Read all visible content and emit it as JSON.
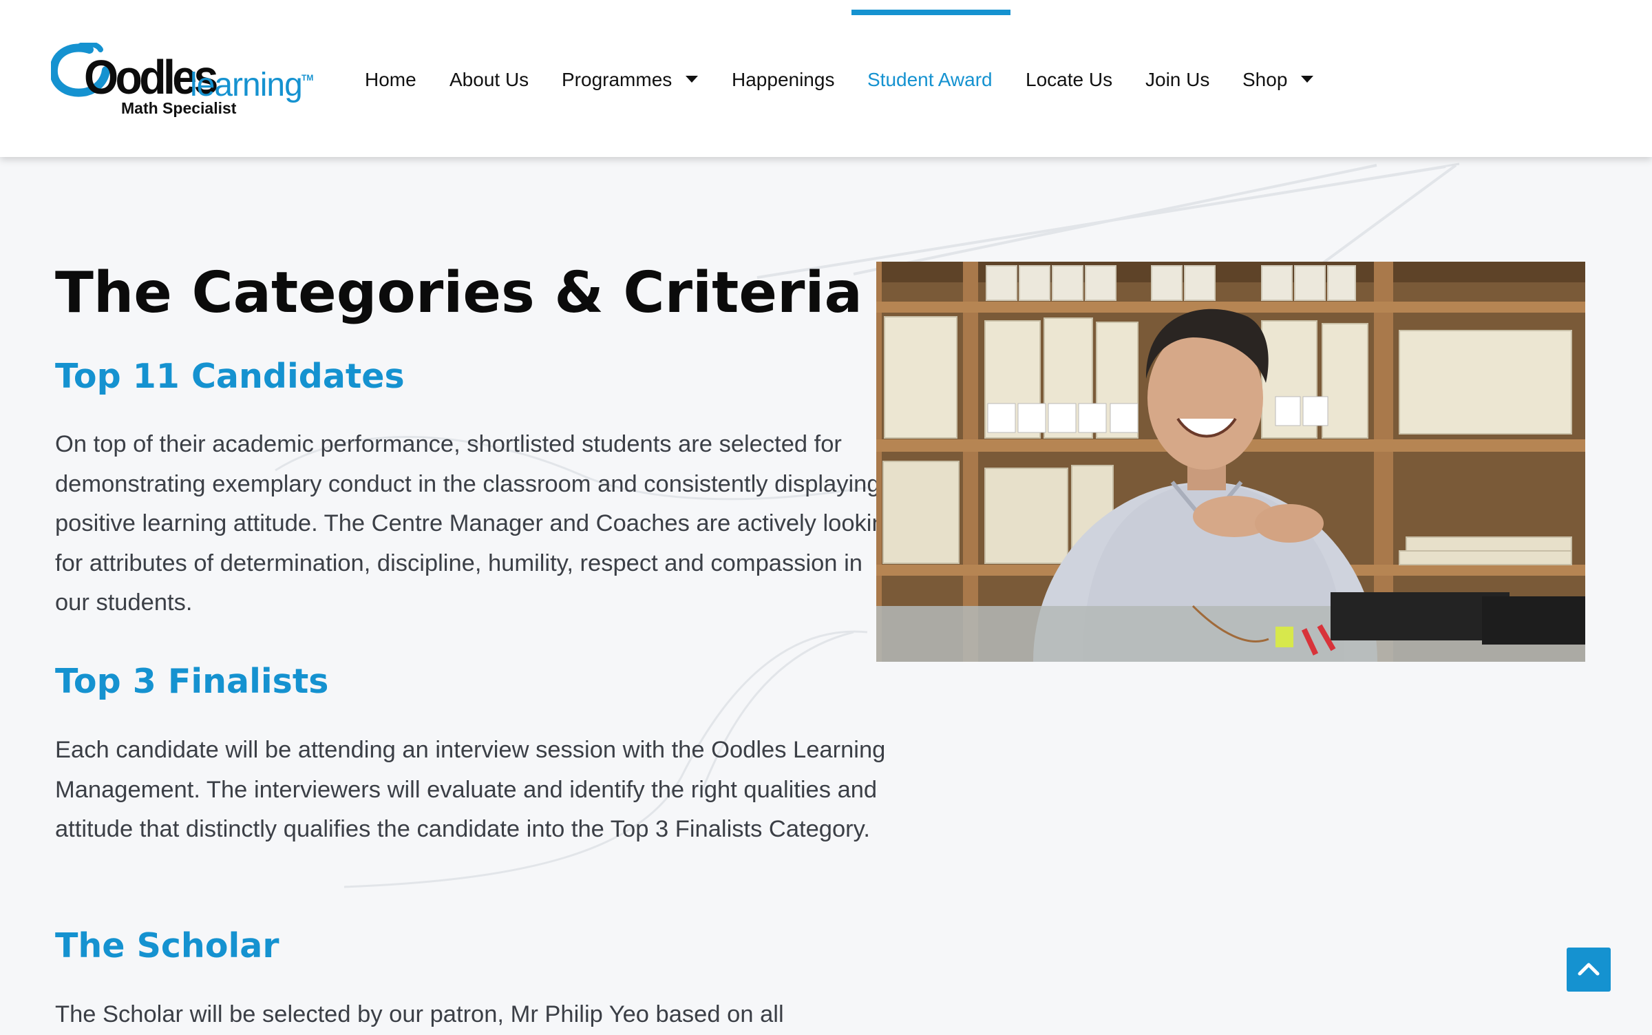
{
  "logo": {
    "word": "Oodles",
    "learning": "learning",
    "tm": "TM",
    "tagline": "Math Specialist"
  },
  "nav": {
    "items": [
      {
        "label": "Home"
      },
      {
        "label": "About Us"
      },
      {
        "label": "Programmes"
      },
      {
        "label": "Happenings"
      },
      {
        "label": "Student Award"
      },
      {
        "label": "Locate Us"
      },
      {
        "label": "Join Us"
      },
      {
        "label": "Shop"
      }
    ],
    "active": "Student Award"
  },
  "main": {
    "title": "The Categories & Criteria",
    "sections": [
      {
        "heading": "Top 11 Candidates",
        "body": "On top of their academic performance, shortlisted students are selected for demonstrating exemplary conduct in the classroom and consistently displaying a positive learning attitude. The Centre Manager and Coaches are actively looking for attributes of determination, discipline, humility, respect and compassion in our students."
      },
      {
        "heading": "Top 3 Finalists",
        "body": "Each candidate will be attending an interview session with the Oodles Learning Management. The interviewers will evaluate and identify the right qualities and attitude that distinctly qualifies the candidate into the Top 3 Finalists Category."
      },
      {
        "heading": "The Scholar",
        "body": "The Scholar will be selected by our patron, Mr Philip Yeo based on all"
      }
    ]
  },
  "colors": {
    "accent": "#1592d0",
    "heading": "#0b0b0b",
    "body_text": "#3b3f46",
    "background": "#f6f7f9"
  },
  "icons": {
    "dropdown": "caret-down-icon",
    "scroll_top": "chevron-up-icon"
  }
}
